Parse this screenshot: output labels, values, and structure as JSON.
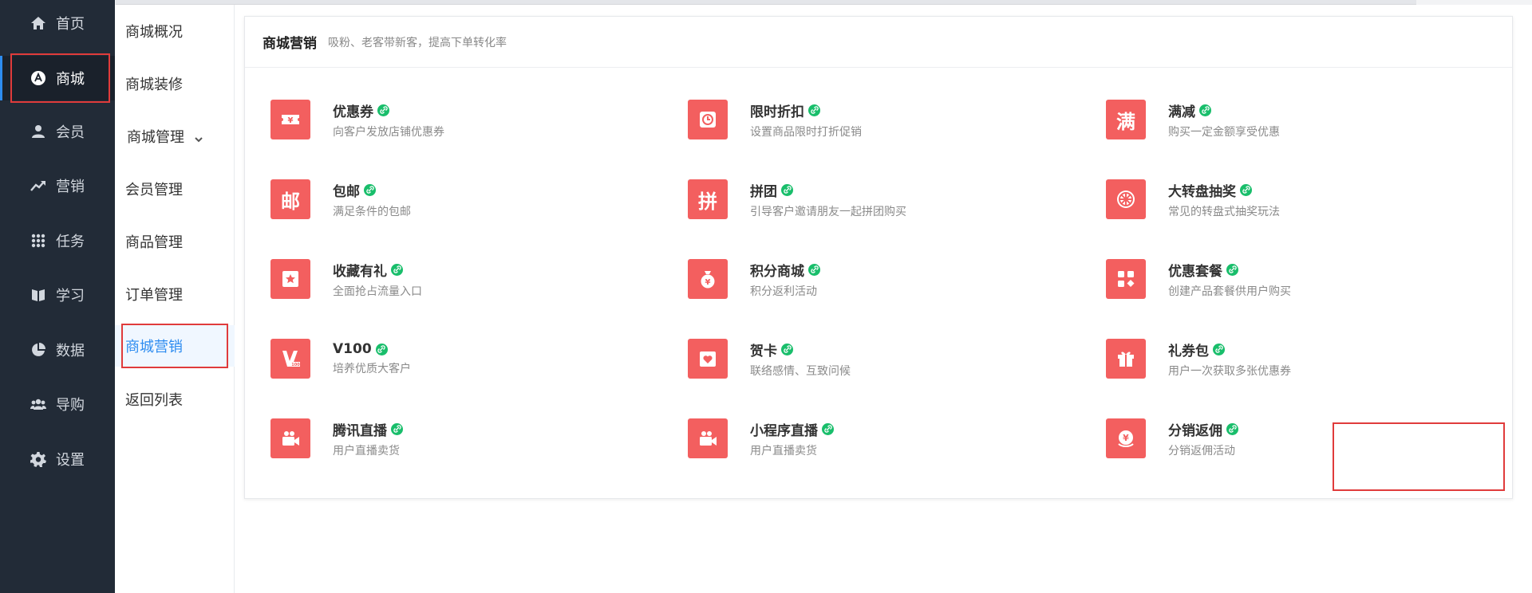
{
  "nav": {
    "items": [
      {
        "label": "首页",
        "icon": "home-icon"
      },
      {
        "label": "商城",
        "icon": "store-icon"
      },
      {
        "label": "会员",
        "icon": "user-icon"
      },
      {
        "label": "营销",
        "icon": "trend-icon"
      },
      {
        "label": "任务",
        "icon": "grid-icon"
      },
      {
        "label": "学习",
        "icon": "book-icon"
      },
      {
        "label": "数据",
        "icon": "pie-icon"
      },
      {
        "label": "导购",
        "icon": "group-icon"
      },
      {
        "label": "设置",
        "icon": "gear-icon"
      }
    ],
    "active": "商城"
  },
  "subnav": {
    "items": [
      {
        "label": "商城概况"
      },
      {
        "label": "商城装修"
      },
      {
        "label": "商城管理",
        "has_chevron": true
      },
      {
        "label": "会员管理"
      },
      {
        "label": "商品管理"
      },
      {
        "label": "订单管理"
      },
      {
        "label": "商城营销",
        "active": true
      },
      {
        "label": "返回列表"
      }
    ]
  },
  "card": {
    "title": "商城营销",
    "subtitle": "吸粉、老客带新客，提高下单转化率"
  },
  "features": [
    {
      "title": "优惠券",
      "desc": "向客户发放店铺优惠券",
      "icon": "coupon-icon"
    },
    {
      "title": "限时折扣",
      "desc": "设置商品限时打折促销",
      "icon": "clock-icon"
    },
    {
      "title": "满减",
      "desc": "购买一定金额享受优惠",
      "icon": "man-text-icon",
      "glyph": "满"
    },
    {
      "title": "包邮",
      "desc": "满足条件的包邮",
      "icon": "mail-text-icon",
      "glyph": "邮"
    },
    {
      "title": "拼团",
      "desc": "引导客户邀请朋友一起拼团购买",
      "icon": "pin-text-icon",
      "glyph": "拼"
    },
    {
      "title": "大转盘抽奖",
      "desc": "常见的转盘式抽奖玩法",
      "icon": "wheel-icon"
    },
    {
      "title": "收藏有礼",
      "desc": "全面抢占流量入口",
      "icon": "star-icon"
    },
    {
      "title": "积分商城",
      "desc": "积分返利活动",
      "icon": "moneybag-icon"
    },
    {
      "title": "优惠套餐",
      "desc": "创建产品套餐供用户购买",
      "icon": "blocks-icon"
    },
    {
      "title": "V100",
      "desc": "培养优质大客户",
      "icon": "v100-icon"
    },
    {
      "title": "贺卡",
      "desc": "联络感情、互致问候",
      "icon": "card-heart-icon"
    },
    {
      "title": "礼券包",
      "desc": "用户一次获取多张优惠券",
      "icon": "gift-icon"
    },
    {
      "title": "腾讯直播",
      "desc": "用户直播卖货",
      "icon": "camera-icon"
    },
    {
      "title": "小程序直播",
      "desc": "用户直播卖货",
      "icon": "camera-icon"
    },
    {
      "title": "分销返佣",
      "desc": "分销返佣活动",
      "icon": "commission-icon"
    }
  ],
  "colors": {
    "sidebar_bg": "#222b37",
    "accent": "#2d8cf0",
    "feature_icon_bg": "#f35f5f",
    "link_badge": "#19be6b",
    "highlight_box": "#e03b3b"
  }
}
